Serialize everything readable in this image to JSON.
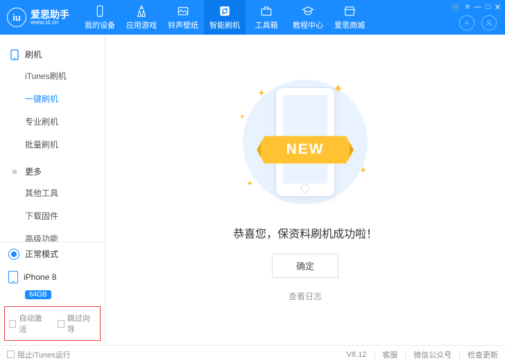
{
  "header": {
    "logo_text": "iu",
    "brand": "爱思助手",
    "url": "www.i4.cn",
    "tabs": [
      {
        "label": "我的设备"
      },
      {
        "label": "应用游戏"
      },
      {
        "label": "铃声壁纸"
      },
      {
        "label": "智能刷机"
      },
      {
        "label": "工具箱"
      },
      {
        "label": "教程中心"
      },
      {
        "label": "爱思商城"
      }
    ]
  },
  "sidebar": {
    "groups": [
      {
        "title": "刷机",
        "items": [
          "iTunes刷机",
          "一键刷机",
          "专业刷机",
          "批量刷机"
        ],
        "activeIndex": 1
      },
      {
        "title": "更多",
        "items": [
          "其他工具",
          "下载固件",
          "高级功能"
        ],
        "activeIndex": -1
      }
    ],
    "mode": "正常模式",
    "device": "iPhone 8",
    "deviceBadge": "64GB",
    "checkboxes": [
      "自动激活",
      "跳过向导"
    ]
  },
  "main": {
    "ribbon": "NEW",
    "message": "恭喜您，保资料刷机成功啦！",
    "ok": "确定",
    "log": "查看日志"
  },
  "footer": {
    "block": "阻止iTunes运行",
    "version": "V8.12",
    "links": [
      "客服",
      "微信公众号",
      "检查更新"
    ]
  }
}
